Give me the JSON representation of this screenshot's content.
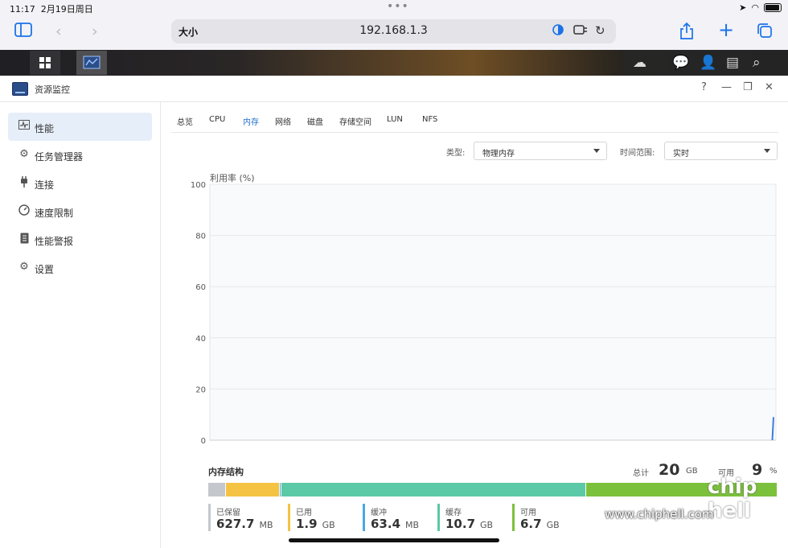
{
  "status_bar": {
    "time": "11:17",
    "date": "2月19日周日",
    "dots": "•••"
  },
  "browser": {
    "text_size_label": "大小",
    "url": "192.168.1.3"
  },
  "window": {
    "title": "资源监控",
    "help": "?",
    "minimize": "—",
    "restore": "❐",
    "close": "✕"
  },
  "sidebar": {
    "items": [
      {
        "label": "性能",
        "icon": "performance-icon"
      },
      {
        "label": "任务管理器",
        "icon": "task-manager-icon"
      },
      {
        "label": "连接",
        "icon": "plug-icon"
      },
      {
        "label": "速度限制",
        "icon": "speedometer-icon"
      },
      {
        "label": "性能警报",
        "icon": "alert-doc-icon"
      },
      {
        "label": "设置",
        "icon": "gear-icon"
      }
    ]
  },
  "tabs": [
    "总览",
    "CPU",
    "内存",
    "网络",
    "磁盘",
    "存储空间",
    "LUN",
    "NFS"
  ],
  "active_tab": "内存",
  "filters": {
    "type_label": "类型:",
    "type_value": "物理内存",
    "range_label": "时间范围:",
    "range_value": "实时"
  },
  "chart_data": {
    "type": "line",
    "ylabel": "利用率 (%)",
    "ylim": [
      0,
      100
    ],
    "yticks": [
      "100",
      "80",
      "60",
      "40",
      "20",
      "0"
    ],
    "grid": true,
    "series": [
      {
        "color": "#3b7ddd",
        "values": [
          0,
          9
        ]
      }
    ]
  },
  "memory": {
    "title": "内存结构",
    "total_label": "总计",
    "total_value": "20",
    "total_unit": "GB",
    "available_label": "可用",
    "available_value": "9",
    "available_unit": "%",
    "segments": [
      {
        "name": "已保留",
        "value": "627.7",
        "unit": "MB",
        "color": "#c4c8cd",
        "fraction": 0.031
      },
      {
        "name": "已用",
        "value": "1.9",
        "unit": "GB",
        "color": "#f5c344",
        "fraction": 0.095
      },
      {
        "name": "缓冲",
        "value": "63.4",
        "unit": "MB",
        "color": "#4aa8e0",
        "fraction": 0.003
      },
      {
        "name": "缓存",
        "value": "10.7",
        "unit": "GB",
        "color": "#5bc8a6",
        "fraction": 0.535
      },
      {
        "name": "可用",
        "value": "6.7",
        "unit": "GB",
        "color": "#7cc13c",
        "fraction": 0.336
      }
    ]
  },
  "watermark": {
    "site": "www.chiphell.com",
    "logo": "chip hell"
  }
}
